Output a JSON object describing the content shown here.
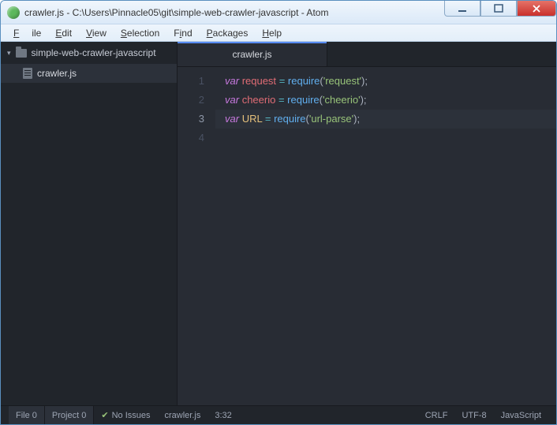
{
  "window": {
    "title": "crawler.js - C:\\Users\\Pinnacle05\\git\\simple-web-crawler-javascript - Atom"
  },
  "menu": {
    "file": "File",
    "edit": "Edit",
    "view": "View",
    "selection": "Selection",
    "find": "Find",
    "packages": "Packages",
    "help": "Help"
  },
  "sidebar": {
    "project": "simple-web-crawler-javascript",
    "files": [
      {
        "name": "crawler.js"
      }
    ]
  },
  "tabs": {
    "active": "crawler.js"
  },
  "editor": {
    "lines": [
      {
        "n": 1,
        "kw": "var",
        "id": "request",
        "idClass": "v1",
        "rhs_fn": "require",
        "rhs_arg": "'request'"
      },
      {
        "n": 2,
        "kw": "var",
        "id": "cheerio",
        "idClass": "v1",
        "rhs_fn": "require",
        "rhs_arg": "'cheerio'"
      },
      {
        "n": 3,
        "kw": "var",
        "id": "URL",
        "idClass": "v2",
        "rhs_fn": "require",
        "rhs_arg": "'url-parse'"
      },
      {
        "n": 4
      }
    ],
    "current_line": 3
  },
  "status": {
    "file_label": "File",
    "file_count": "0",
    "project_label": "Project",
    "project_count": "0",
    "issues": "No Issues",
    "filename": "crawler.js",
    "cursor": "3:32",
    "eol": "CRLF",
    "encoding": "UTF-8",
    "language": "JavaScript"
  }
}
